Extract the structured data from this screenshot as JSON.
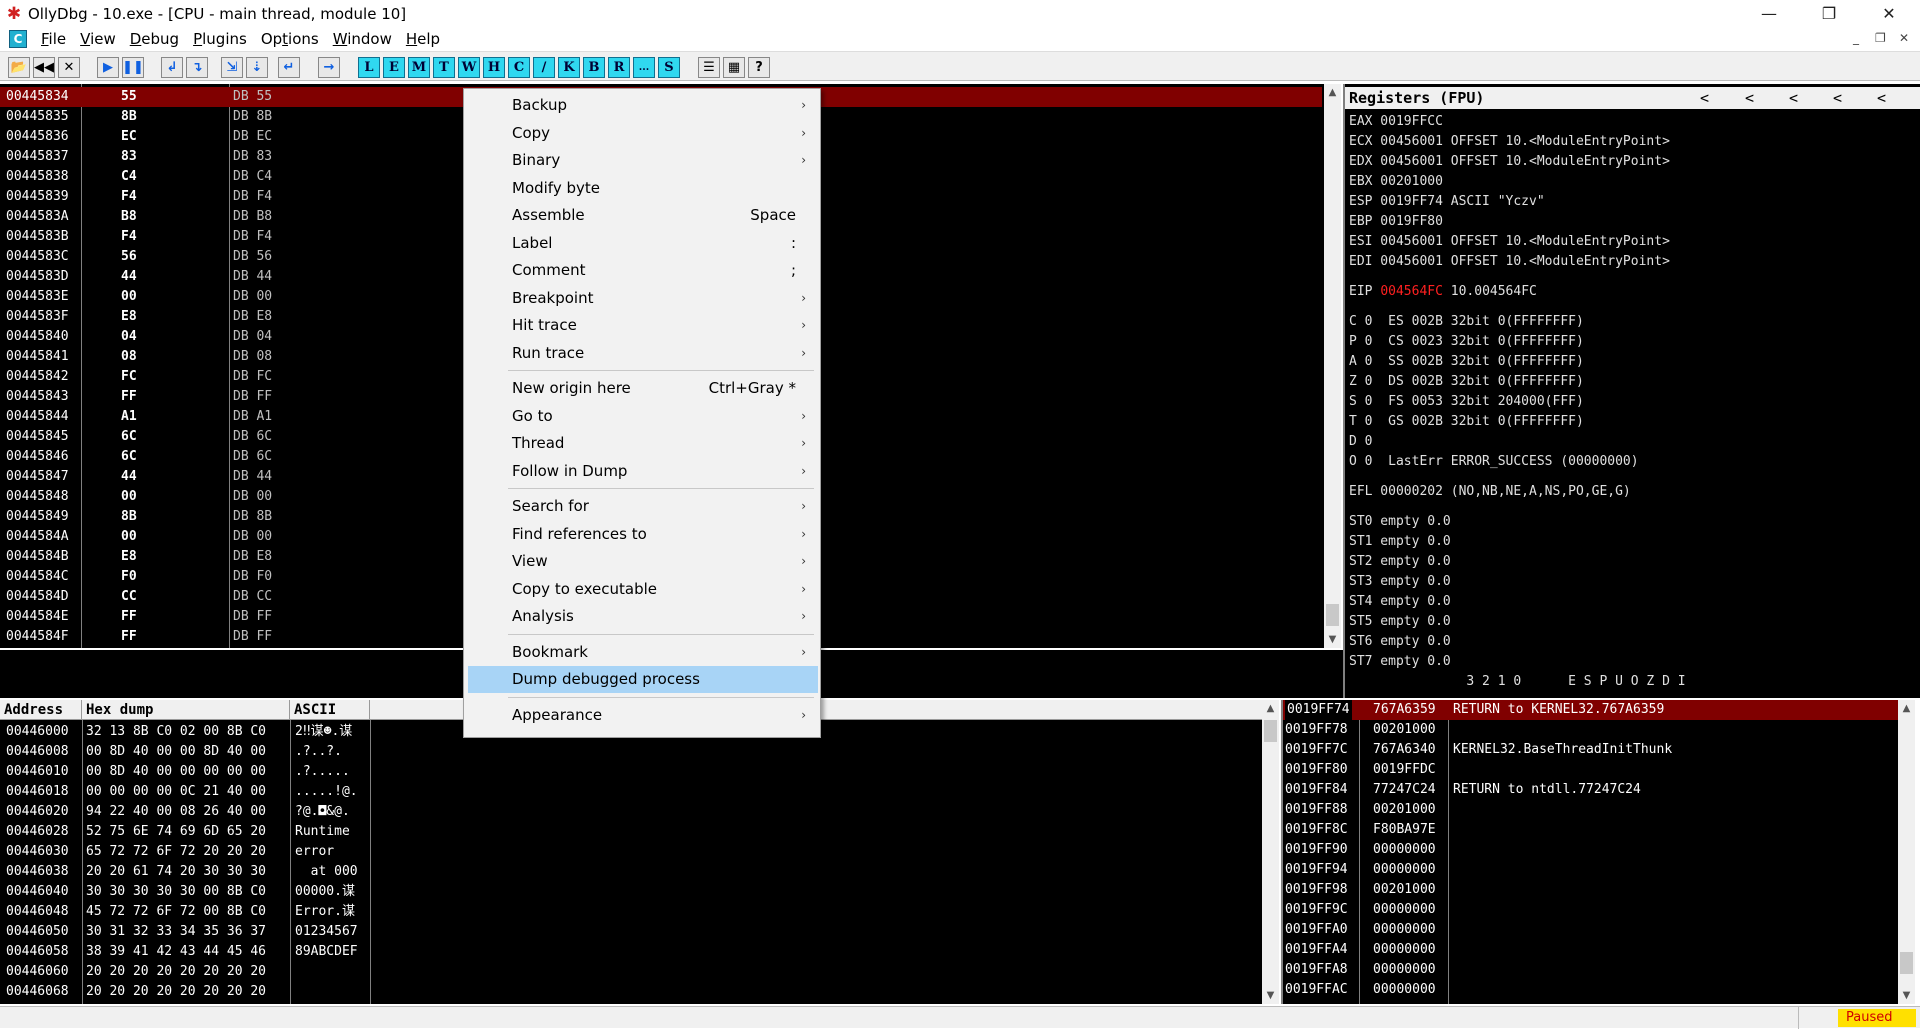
{
  "window": {
    "title": "OllyDbg - 10.exe - [CPU - main thread, module 10]",
    "min": "—",
    "restore": "❐",
    "close": "✕"
  },
  "menubar": {
    "mdi_icon": "C",
    "items": [
      {
        "u": "F",
        "rest": "ile"
      },
      {
        "u": "V",
        "rest": "iew"
      },
      {
        "u": "D",
        "rest": "ebug"
      },
      {
        "u": "P",
        "rest": "lugins"
      },
      {
        "pre": "Op",
        "u": "t",
        "rest": "ions"
      },
      {
        "u": "W",
        "rest": "indow"
      },
      {
        "u": "H",
        "rest": "elp"
      }
    ],
    "mdi_buttons": [
      "_",
      "❐",
      "✕"
    ]
  },
  "toolbar": {
    "left": [
      {
        "name": "open-icon",
        "g": "📂"
      },
      {
        "name": "restart-icon",
        "g": "◀◀"
      },
      {
        "name": "close-program-icon",
        "g": "✕"
      },
      {
        "name": "run-icon",
        "g": "▶"
      },
      {
        "name": "pause-icon",
        "g": "❚❚"
      },
      {
        "name": "step-into-icon",
        "g": "↲"
      },
      {
        "name": "step-over-icon",
        "g": "↴"
      },
      {
        "name": "trace-into-icon",
        "g": "⇲"
      },
      {
        "name": "trace-over-icon",
        "g": "⇣"
      },
      {
        "name": "execute-till-return-icon",
        "g": "↵"
      },
      {
        "name": "go-to-icon",
        "g": "→"
      }
    ],
    "letters": [
      "L",
      "E",
      "M",
      "T",
      "W",
      "H",
      "C",
      "/",
      "K",
      "B",
      "R",
      "...",
      "S"
    ],
    "right": [
      {
        "name": "list-icon",
        "g": "☰"
      },
      {
        "name": "grid-icon",
        "g": "▦"
      },
      {
        "name": "help-icon",
        "g": "?"
      }
    ]
  },
  "disasm": {
    "rows": [
      {
        "addr": "00445834",
        "hex": "55",
        "cmd": "DB 55"
      },
      {
        "addr": "00445835",
        "hex": "8B",
        "cmd": "DB 8B"
      },
      {
        "addr": "00445836",
        "hex": "EC",
        "cmd": "DB EC"
      },
      {
        "addr": "00445837",
        "hex": "83",
        "cmd": "DB 83"
      },
      {
        "addr": "00445838",
        "hex": "C4",
        "cmd": "DB C4"
      },
      {
        "addr": "00445839",
        "hex": "F4",
        "cmd": "DB F4"
      },
      {
        "addr": "0044583A",
        "hex": "B8",
        "cmd": "DB B8"
      },
      {
        "addr": "0044583B",
        "hex": "F4",
        "cmd": "DB F4"
      },
      {
        "addr": "0044583C",
        "hex": "56",
        "cmd": "DB 56"
      },
      {
        "addr": "0044583D",
        "hex": "44",
        "cmd": "DB 44"
      },
      {
        "addr": "0044583E",
        "hex": "00",
        "cmd": "DB 00"
      },
      {
        "addr": "0044583F",
        "hex": "E8",
        "cmd": "DB E8"
      },
      {
        "addr": "00445840",
        "hex": "04",
        "cmd": "DB 04"
      },
      {
        "addr": "00445841",
        "hex": "08",
        "cmd": "DB 08"
      },
      {
        "addr": "00445842",
        "hex": "FC",
        "cmd": "DB FC"
      },
      {
        "addr": "00445843",
        "hex": "FF",
        "cmd": "DB FF"
      },
      {
        "addr": "00445844",
        "hex": "A1",
        "cmd": "DB A1"
      },
      {
        "addr": "00445845",
        "hex": "6C",
        "cmd": "DB 6C"
      },
      {
        "addr": "00445846",
        "hex": "6C",
        "cmd": "DB 6C"
      },
      {
        "addr": "00445847",
        "hex": "44",
        "cmd": "DB 44"
      },
      {
        "addr": "00445848",
        "hex": "00",
        "cmd": "DB 00"
      },
      {
        "addr": "00445849",
        "hex": "8B",
        "cmd": "DB 8B"
      },
      {
        "addr": "0044584A",
        "hex": "00",
        "cmd": "DB 00"
      },
      {
        "addr": "0044584B",
        "hex": "E8",
        "cmd": "DB E8"
      },
      {
        "addr": "0044584C",
        "hex": "F0",
        "cmd": "DB F0"
      },
      {
        "addr": "0044584D",
        "hex": "CC",
        "cmd": "DB CC"
      },
      {
        "addr": "0044584E",
        "hex": "FF",
        "cmd": "DB FF"
      },
      {
        "addr": "0044584F",
        "hex": "FF",
        "cmd": "DB FF"
      }
    ]
  },
  "registers": {
    "header": "Registers (FPU)",
    "nav": [
      "<",
      "<",
      "<",
      "<",
      "<"
    ],
    "gp": [
      "EAX 0019FFCC",
      "ECX 00456001 OFFSET 10.<ModuleEntryPoint>",
      "EDX 00456001 OFFSET 10.<ModuleEntryPoint>",
      "EBX 00201000",
      "ESP 0019FF74 ASCII \"Yczv\"",
      "EBP 0019FF80",
      "ESI 00456001 OFFSET 10.<ModuleEntryPoint>",
      "EDI 00456001 OFFSET 10.<ModuleEntryPoint>"
    ],
    "eip_label": "EIP ",
    "eip_value": "004564FC",
    "eip_rest": " 10.004564FC",
    "flags": [
      "C 0  ES 002B 32bit 0(FFFFFFFF)",
      "P 0  CS 0023 32bit 0(FFFFFFFF)",
      "A 0  SS 002B 32bit 0(FFFFFFFF)",
      "Z 0  DS 002B 32bit 0(FFFFFFFF)",
      "S 0  FS 0053 32bit 204000(FFF)",
      "T 0  GS 002B 32bit 0(FFFFFFFF)",
      "D 0",
      "O 0  LastErr ERROR_SUCCESS (00000000)"
    ],
    "efl": "EFL 00000202 (NO,NB,NE,A,NS,PO,GE,G)",
    "st": [
      "ST0 empty 0.0",
      "ST1 empty 0.0",
      "ST2 empty 0.0",
      "ST3 empty 0.0",
      "ST4 empty 0.0",
      "ST5 empty 0.0",
      "ST6 empty 0.0",
      "ST7 empty 0.0"
    ],
    "fpu_bits": "               3 2 1 0      E S P U O Z D I"
  },
  "dump": {
    "headers": {
      "address": "Address",
      "hex": "Hex dump",
      "ascii": "ASCII"
    },
    "rows": [
      {
        "addr": "00446000",
        "hex": "32 13 8B C0 02 00 8B C0",
        "ascii": "2‼谋☻.谋"
      },
      {
        "addr": "00446008",
        "hex": "00 8D 40 00 00 8D 40 00",
        "ascii": ".?..?."
      },
      {
        "addr": "00446010",
        "hex": "00 8D 40 00 00 00 00 00",
        "ascii": ".?....."
      },
      {
        "addr": "00446018",
        "hex": "00 00 00 00 0C 21 40 00",
        "ascii": ".....!@."
      },
      {
        "addr": "00446020",
        "hex": "94 22 40 00 08 26 40 00",
        "ascii": "?@.◘&@."
      },
      {
        "addr": "00446028",
        "hex": "52 75 6E 74 69 6D 65 20",
        "ascii": "Runtime "
      },
      {
        "addr": "00446030",
        "hex": "65 72 72 6F 72 20 20 20",
        "ascii": "error   "
      },
      {
        "addr": "00446038",
        "hex": "20 20 61 74 20 30 30 30",
        "ascii": "  at 000"
      },
      {
        "addr": "00446040",
        "hex": "30 30 30 30 30 00 8B C0",
        "ascii": "00000.谋"
      },
      {
        "addr": "00446048",
        "hex": "45 72 72 6F 72 00 8B C0",
        "ascii": "Error.谋"
      },
      {
        "addr": "00446050",
        "hex": "30 31 32 33 34 35 36 37",
        "ascii": "01234567"
      },
      {
        "addr": "00446058",
        "hex": "38 39 41 42 43 44 45 46",
        "ascii": "89ABCDEF"
      },
      {
        "addr": "00446060",
        "hex": "20 20 20 20 20 20 20 20",
        "ascii": "        "
      },
      {
        "addr": "00446068",
        "hex": "20 20 20 20 20 20 20 20",
        "ascii": "        "
      }
    ]
  },
  "stack": {
    "rows": [
      {
        "addr": "0019FF74",
        "val": "767A6359",
        "cmt": "RETURN to KERNEL32.767A6359"
      },
      {
        "addr": "0019FF78",
        "val": "00201000",
        "cmt": ""
      },
      {
        "addr": "0019FF7C",
        "val": "767A6340",
        "cmt": "KERNEL32.BaseThreadInitThunk"
      },
      {
        "addr": "0019FF80",
        "val": "0019FFDC",
        "cmt": ""
      },
      {
        "addr": "0019FF84",
        "val": "77247C24",
        "cmt": "RETURN to ntdll.77247C24"
      },
      {
        "addr": "0019FF88",
        "val": "00201000",
        "cmt": ""
      },
      {
        "addr": "0019FF8C",
        "val": "F80BA97E",
        "cmt": ""
      },
      {
        "addr": "0019FF90",
        "val": "00000000",
        "cmt": ""
      },
      {
        "addr": "0019FF94",
        "val": "00000000",
        "cmt": ""
      },
      {
        "addr": "0019FF98",
        "val": "00201000",
        "cmt": ""
      },
      {
        "addr": "0019FF9C",
        "val": "00000000",
        "cmt": ""
      },
      {
        "addr": "0019FFA0",
        "val": "00000000",
        "cmt": ""
      },
      {
        "addr": "0019FFA4",
        "val": "00000000",
        "cmt": ""
      },
      {
        "addr": "0019FFA8",
        "val": "00000000",
        "cmt": ""
      },
      {
        "addr": "0019FFAC",
        "val": "00000000",
        "cmt": ""
      }
    ]
  },
  "context_menu": {
    "items": [
      {
        "label": "Backup",
        "shortcut": "",
        "submenu": true
      },
      {
        "label": "Copy",
        "shortcut": "",
        "submenu": true
      },
      {
        "label": "Binary",
        "shortcut": "",
        "submenu": true
      },
      {
        "label": "Modify byte",
        "shortcut": "",
        "submenu": false
      },
      {
        "label": "Assemble",
        "shortcut": "Space",
        "submenu": false
      },
      {
        "label": "Label",
        "shortcut": ":",
        "submenu": false
      },
      {
        "label": "Comment",
        "shortcut": ";",
        "submenu": false
      },
      {
        "label": "Breakpoint",
        "shortcut": "",
        "submenu": true
      },
      {
        "label": "Hit trace",
        "shortcut": "",
        "submenu": true
      },
      {
        "label": "Run trace",
        "shortcut": "",
        "submenu": true,
        "sep_after": true
      },
      {
        "label": "New origin here",
        "shortcut": "Ctrl+Gray *",
        "submenu": false
      },
      {
        "label": "Go to",
        "shortcut": "",
        "submenu": true
      },
      {
        "label": "Thread",
        "shortcut": "",
        "submenu": true
      },
      {
        "label": "Follow in Dump",
        "shortcut": "",
        "submenu": true,
        "sep_after": true
      },
      {
        "label": "Search for",
        "shortcut": "",
        "submenu": true
      },
      {
        "label": "Find references to",
        "shortcut": "",
        "submenu": true
      },
      {
        "label": "View",
        "shortcut": "",
        "submenu": true
      },
      {
        "label": "Copy to executable",
        "shortcut": "",
        "submenu": true
      },
      {
        "label": "Analysis",
        "shortcut": "",
        "submenu": true,
        "sep_after": true
      },
      {
        "label": "Bookmark",
        "shortcut": "",
        "submenu": true
      },
      {
        "label": "Dump debugged process",
        "shortcut": "",
        "submenu": false,
        "highlighted": true,
        "sep_after": true
      },
      {
        "label": "Appearance",
        "shortcut": "",
        "submenu": true
      }
    ]
  },
  "status": {
    "text": "Paused"
  },
  "colors": {
    "selection": "#800000",
    "eip": "#ff2020",
    "menu_highlight": "#a8d4f6",
    "toolbar_letter": "#30d8f0",
    "status_bg": "#ffe000",
    "status_fg": "#d00000"
  }
}
